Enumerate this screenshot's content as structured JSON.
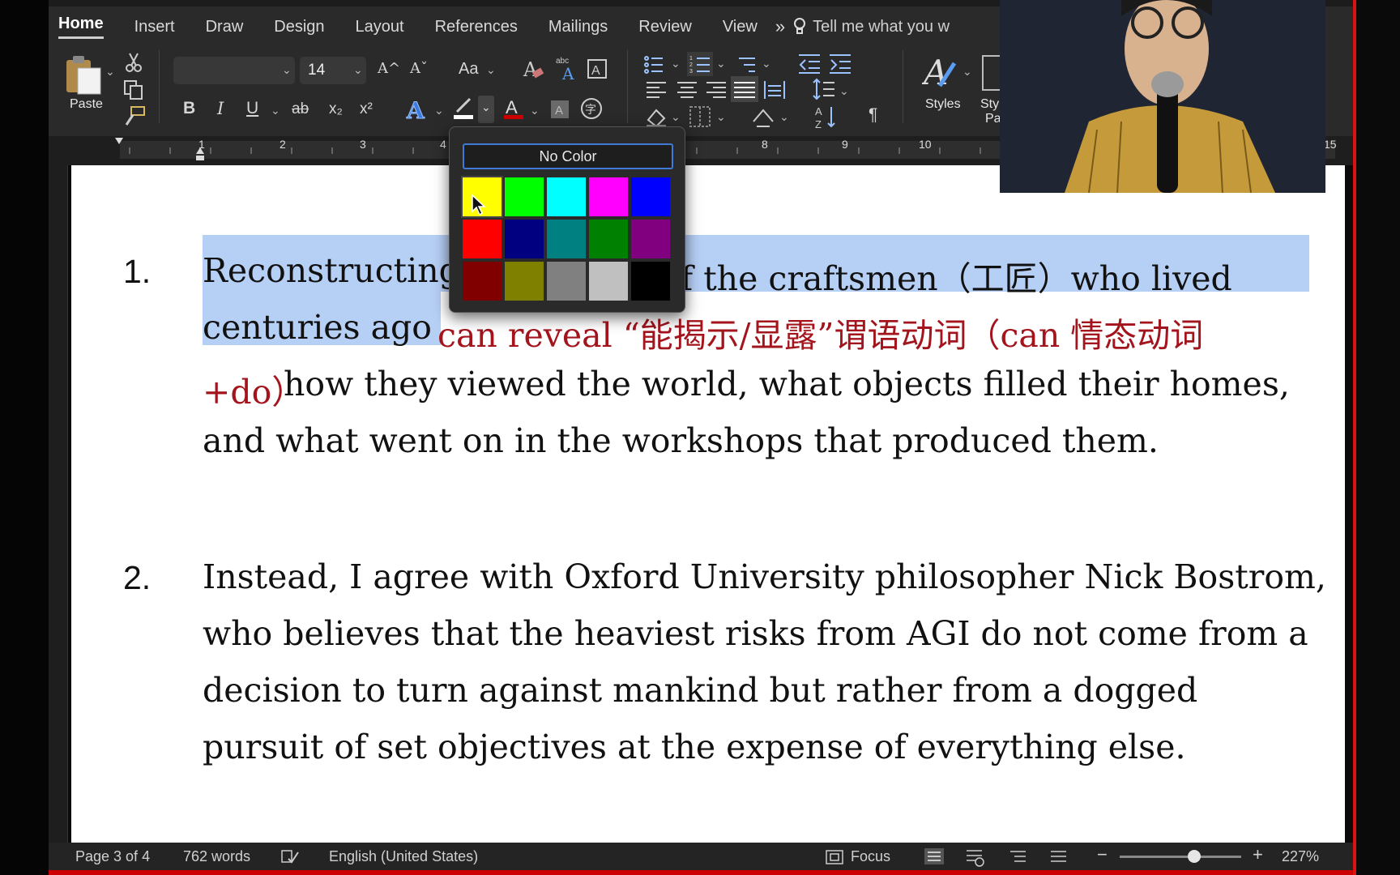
{
  "ribbon": {
    "tabs": [
      "Home",
      "Insert",
      "Draw",
      "Design",
      "Layout",
      "References",
      "Mailings",
      "Review",
      "View"
    ],
    "more": "»",
    "tell_me": "Tell me what you w",
    "font_size": "14",
    "paste_label": "Paste",
    "styles_label": "Styles",
    "styles_pane_label_1": "Sty",
    "styles_pane_label_2": "Pa",
    "bold": "B",
    "italic": "I",
    "underline": "U",
    "strike": "ab",
    "subscript": "x₂",
    "superscript": "x²",
    "change_case": "Aa",
    "grow_font": "A^",
    "shrink_font": "Aˇ",
    "pilcrow": "¶",
    "abc": "abc"
  },
  "ruler": {
    "numbers": [
      "1",
      "2",
      "3",
      "4",
      "8",
      "9",
      "10",
      "15"
    ]
  },
  "color_popup": {
    "no_color_label": "No Color",
    "swatches": [
      [
        "#ffff00",
        "#00ff00",
        "#00ffff",
        "#ff00ff",
        "#0000ff"
      ],
      [
        "#ff0000",
        "#000080",
        "#008080",
        "#008000",
        "#800080"
      ],
      [
        "#800000",
        "#808000",
        "#808080",
        "#c0c0c0",
        "#000000"
      ]
    ]
  },
  "document": {
    "item1_number": "1.",
    "item1_line1_a": "Reconstructing",
    "item1_line1_b": "f  the  craftsmen（工匠）who  lived",
    "item1_line2_a": "centuries ago",
    "item1_line2_b": " can reveal “能揭示/显露”谓语动词（can 情态动词",
    "item1_line3_a": "+do）",
    "item1_line3_b": "  how they viewed the world, what objects filled their homes,",
    "item1_line4": "and what went on in the workshops that produced them.",
    "item2_number": "2.",
    "item2_line1": "Instead, I agree with Oxford University philosopher Nick Bostrom,",
    "item2_line2": "who believes that the heaviest risks from AGI do not come from a",
    "item2_line3": "decision  to  turn  against  mankind  but  rather  from  a  dogged",
    "item2_line4": "pursuit of set objectives at the expense of everything else."
  },
  "status": {
    "page": "Page 3 of 4",
    "words": "762 words",
    "language": "English (United States)",
    "focus": "Focus",
    "zoom": "227%",
    "minus": "−",
    "plus": "+"
  },
  "colors": {
    "selection": "#b6cff5",
    "red_text": "#a3141d",
    "accent_blue": "#3f7ad6"
  }
}
